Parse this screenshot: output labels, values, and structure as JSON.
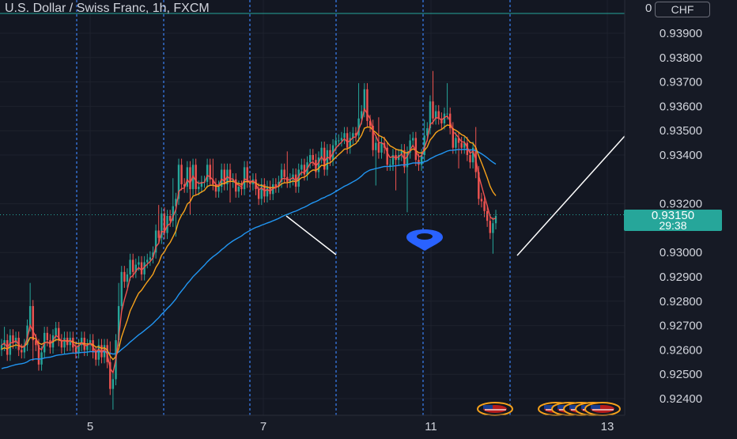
{
  "header": {
    "title": "U.S. Dollar / Swiss Franc, 1h, FXCM",
    "currency_zero": "0",
    "currency": "CHF"
  },
  "last_price": {
    "price": "0.93150",
    "countdown": "29:38"
  },
  "chart_data": {
    "type": "candlestick",
    "title": "U.S. Dollar / Swiss Franc, 1h, FXCM",
    "y_ticks": [
      0.939,
      0.938,
      0.937,
      0.936,
      0.935,
      0.934,
      0.932,
      0.93,
      0.929,
      0.928,
      0.927,
      0.926,
      0.925,
      0.924
    ],
    "y_tick_labels": [
      "0.93900",
      "0.93800",
      "0.93700",
      "0.93600",
      "0.93500",
      "0.93400",
      "0.93200",
      "0.93000",
      "0.92900",
      "0.92800",
      "0.92700",
      "0.92600",
      "0.92500",
      "0.92400"
    ],
    "x_ticks": [
      "5",
      "7",
      "11",
      "13"
    ],
    "ylim": [
      0.9235,
      0.9402
    ],
    "session_separators": 6,
    "last_price": 0.9315,
    "colors": {
      "up": "#26a69a",
      "down": "#ef5350",
      "ema_fast": "#ef5350",
      "ema_mid": "#f7a21b",
      "ema_slow": "#2196f3",
      "separator": "#3b82f6"
    },
    "annotations": [
      "blue map-pin marker",
      "white trend line",
      "white trend line",
      "economic event flags"
    ],
    "closes": [
      0.9262,
      0.9264,
      0.9258,
      0.9266,
      0.9263,
      0.9265,
      0.926,
      0.9259,
      0.9262,
      0.927,
      0.9278,
      0.9264,
      0.9262,
      0.9254,
      0.9259,
      0.9267,
      0.9264,
      0.9261,
      0.9266,
      0.9269,
      0.9264,
      0.9261,
      0.9265,
      0.9262,
      0.9265,
      0.9261,
      0.9259,
      0.9262,
      0.9265,
      0.926,
      0.9262,
      0.9264,
      0.9259,
      0.9256,
      0.9262,
      0.9257,
      0.9262,
      0.9255,
      0.9244,
      0.9248,
      0.9264,
      0.9278,
      0.9292,
      0.9288,
      0.9291,
      0.9297,
      0.9292,
      0.9295,
      0.9296,
      0.9291,
      0.9296,
      0.9297,
      0.9298,
      0.93,
      0.9309,
      0.9306,
      0.9316,
      0.9308,
      0.9315,
      0.9313,
      0.9319,
      0.9322,
      0.9336,
      0.9328,
      0.9327,
      0.9335,
      0.9326,
      0.9336,
      0.9326,
      0.9327,
      0.9329,
      0.9329,
      0.9336,
      0.933,
      0.9328,
      0.9325,
      0.9327,
      0.9334,
      0.9328,
      0.9334,
      0.9329,
      0.933,
      0.9325,
      0.9327,
      0.9326,
      0.9335,
      0.9329,
      0.9328,
      0.933,
      0.9326,
      0.9322,
      0.9328,
      0.9323,
      0.9327,
      0.9324,
      0.9328,
      0.9327,
      0.9329,
      0.9334,
      0.9331,
      0.9329,
      0.933,
      0.9332,
      0.9327,
      0.9334,
      0.9336,
      0.9332,
      0.9337,
      0.934,
      0.9338,
      0.9333,
      0.9339,
      0.9343,
      0.9334,
      0.9342,
      0.9338,
      0.9344,
      0.9346,
      0.9346,
      0.9347,
      0.9349,
      0.9343,
      0.9347,
      0.9349,
      0.9348,
      0.9355,
      0.9358,
      0.9367,
      0.9354,
      0.9352,
      0.9342,
      0.9345,
      0.9341,
      0.9345,
      0.9343,
      0.9336,
      0.9336,
      0.934,
      0.9338,
      0.934,
      0.9342,
      0.9335,
      0.9341,
      0.9346,
      0.9347,
      0.9338,
      0.9336,
      0.934,
      0.9348,
      0.9351,
      0.9362,
      0.9355,
      0.9358,
      0.9355,
      0.9353,
      0.9357,
      0.9357,
      0.9351,
      0.9343,
      0.9347,
      0.9345,
      0.9343,
      0.9345,
      0.934,
      0.9337,
      0.9343,
      0.9333,
      0.9322,
      0.9321,
      0.9317,
      0.9313,
      0.9308,
      0.9312,
      0.9315
    ]
  }
}
